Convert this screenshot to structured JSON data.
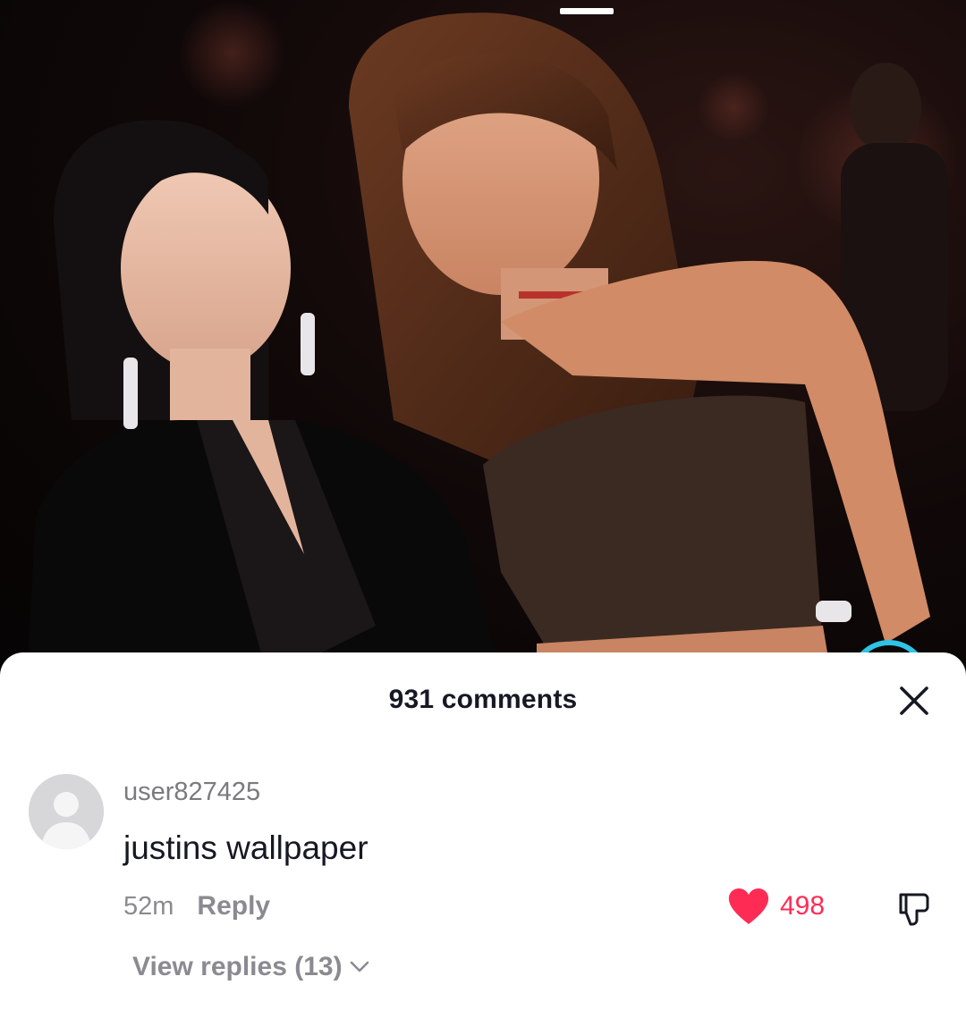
{
  "video": {
    "description_icon": "photo-post"
  },
  "comments_panel": {
    "title": "931 comments",
    "close_icon": "close-icon"
  },
  "comment": {
    "username": "user827425",
    "text": "justins wallpaper",
    "timestamp": "52m",
    "reply_label": "Reply",
    "like_count": "498",
    "liked": true,
    "view_replies_label": "View replies (13)"
  },
  "colors": {
    "like_red": "#fe2c55",
    "text_primary": "#161823",
    "text_secondary": "#8a8b91",
    "accent_ring": "#2fc3e6"
  }
}
